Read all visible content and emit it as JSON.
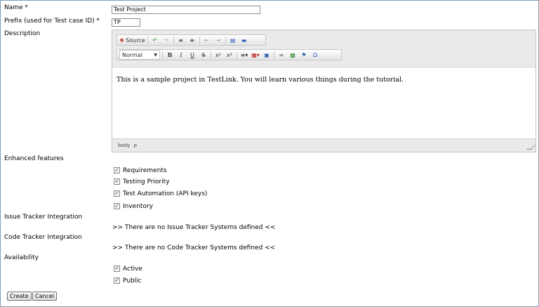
{
  "form": {
    "name_label": "Name *",
    "name_value": "Test Project",
    "prefix_label": "Prefix (used for Test case ID) *",
    "prefix_value": "TP",
    "description_label": "Description",
    "enhanced_label": "Enhanced features",
    "issue_tracker_label": "Issue Tracker Integration",
    "issue_tracker_msg": ">> There are no Issue Tracker Systems defined <<",
    "code_tracker_label": "Code Tracker Integration",
    "code_tracker_msg": ">> There are no Code Tracker Systems defined <<",
    "availability_label": "Availability"
  },
  "editor": {
    "source_label": "Source",
    "format_select": "Normal",
    "content": "This is a sample project in TestLink. You will learn various things during the tutorial.",
    "path_body": "body",
    "path_p": "p"
  },
  "features": [
    {
      "label": "Requirements",
      "checked": true
    },
    {
      "label": "Testing Priority",
      "checked": true
    },
    {
      "label": "Test Automation (API keys)",
      "checked": true
    },
    {
      "label": "Inventory",
      "checked": true
    }
  ],
  "availability": [
    {
      "label": "Active",
      "checked": true
    },
    {
      "label": "Public",
      "checked": true
    }
  ],
  "buttons": {
    "create": "Create",
    "cancel": "Cancel"
  },
  "icons": {
    "source": "source-icon",
    "undo": "undo-icon",
    "redo": "redo-icon",
    "numbered_list": "numbered-list-icon",
    "bulleted_list": "bulleted-list-icon",
    "outdent": "outdent-icon",
    "indent": "indent-icon",
    "table": "table-icon",
    "image": "image-icon",
    "link": "link-icon",
    "anchor": "anchor-icon",
    "flag": "flag-icon",
    "special_char": "special-char-icon"
  }
}
